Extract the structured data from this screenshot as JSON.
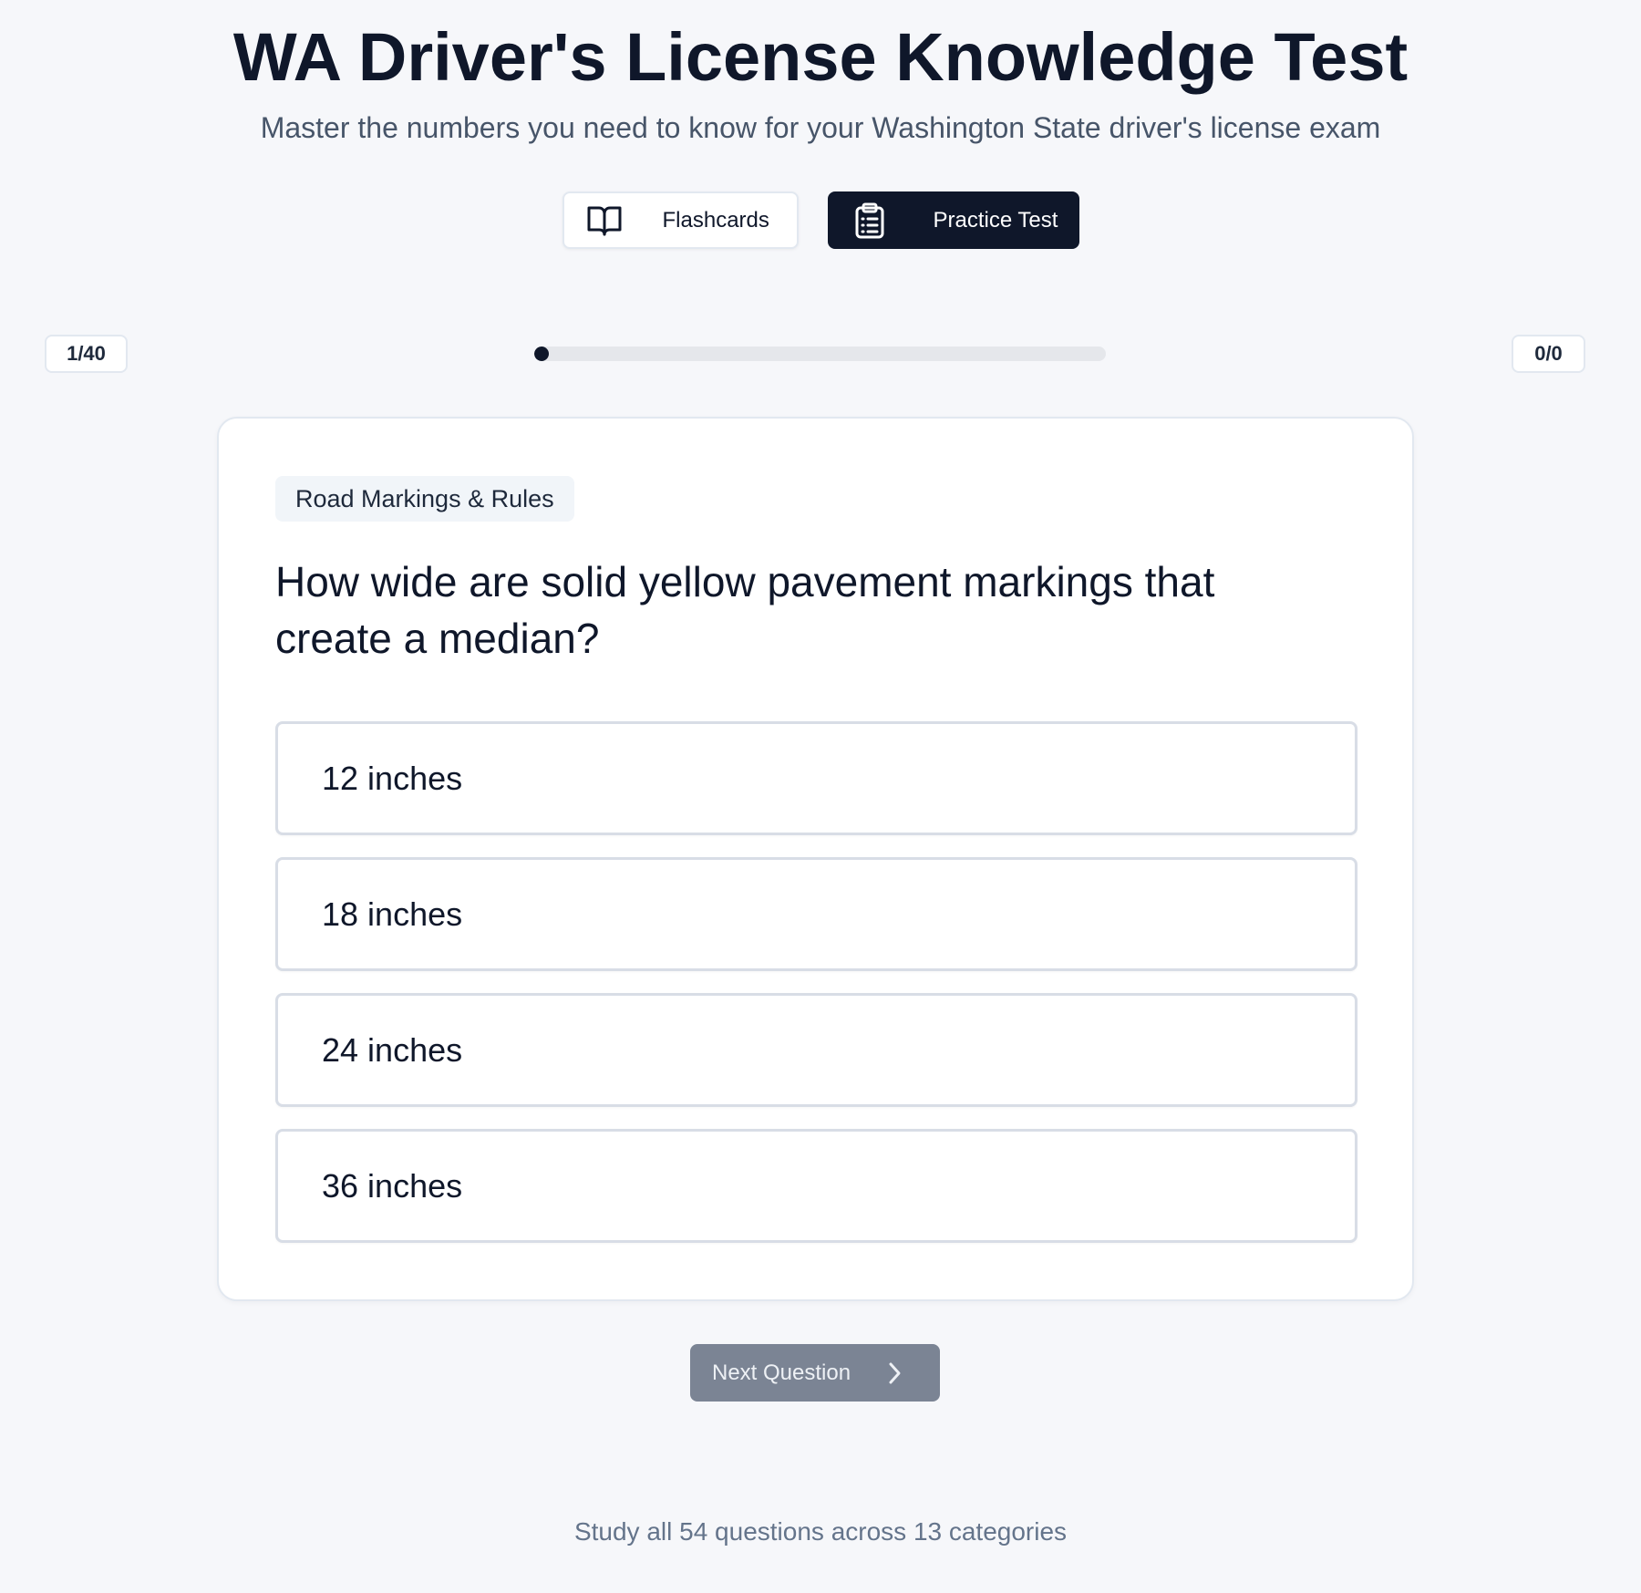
{
  "header": {
    "title": "WA Driver's License Knowledge Test",
    "subtitle": "Master the numbers you need to know for your Washington State driver's license exam"
  },
  "modes": {
    "flashcards": {
      "label": "Flashcards",
      "icon": "book-open-icon",
      "active": false
    },
    "practice_test": {
      "label": "Practice Test",
      "icon": "clipboard-list-icon",
      "active": true
    }
  },
  "progress": {
    "question_counter": "1/40",
    "score": "0/0",
    "fraction": 0.025
  },
  "question_card": {
    "category": "Road Markings & Rules",
    "question": "How wide are solid yellow pavement markings that create a median?",
    "options": [
      {
        "label": "12 inches"
      },
      {
        "label": "18 inches"
      },
      {
        "label": "24 inches"
      },
      {
        "label": "36 inches"
      }
    ]
  },
  "actions": {
    "next_label": "Next Question",
    "next_icon": "chevron-right-icon",
    "next_enabled": false
  },
  "footer": {
    "note": "Study all 54 questions across 13 categories"
  },
  "colors": {
    "primary": "#0f172a",
    "background": "#f6f7fa",
    "disabled_button": "#7b8494"
  }
}
